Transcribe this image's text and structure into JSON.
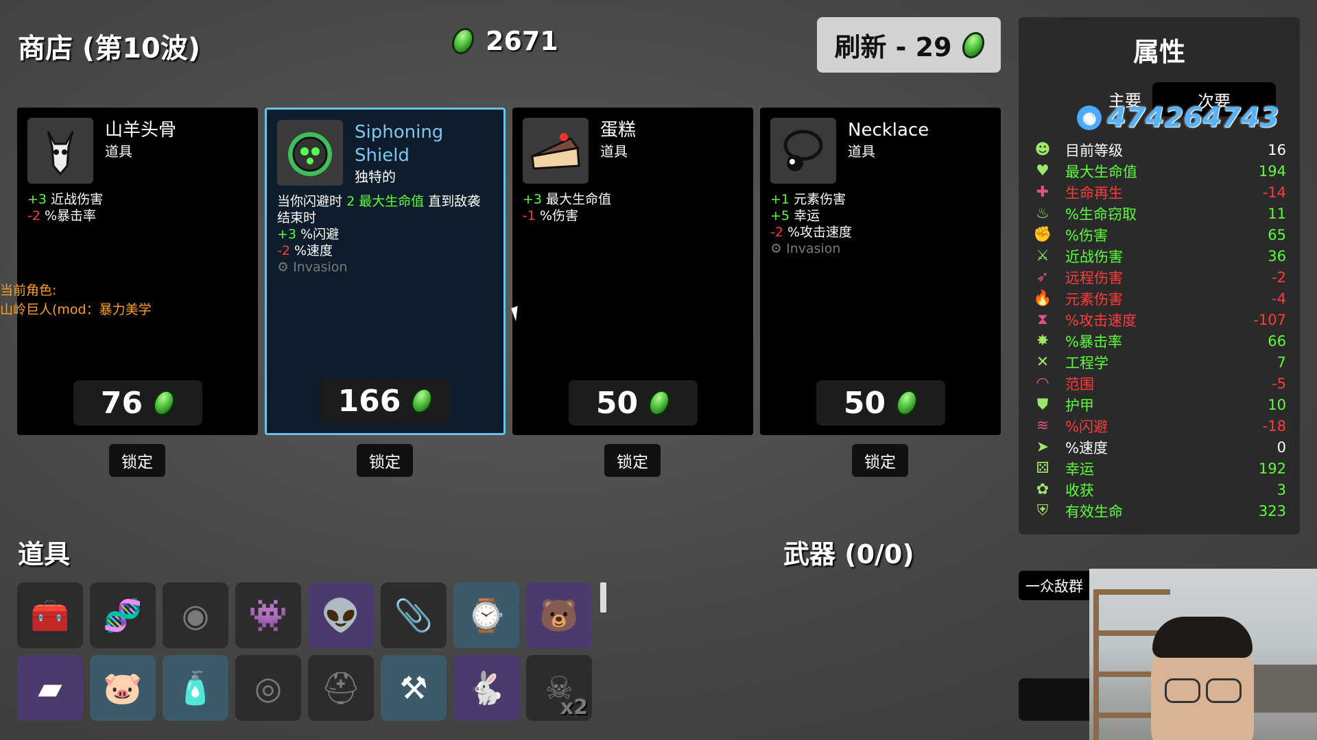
{
  "header": {
    "shop_title": "商店 (第10波)",
    "gold": "2671",
    "refresh_label": "刷新 - 29"
  },
  "shop_cards": [
    {
      "name": "山羊头骨",
      "kind": "道具",
      "price": "76",
      "lock_label": "锁定",
      "icon": "goat-skull-icon",
      "stats": [
        {
          "val": "+3",
          "txt": "近战伤害",
          "tone": "g"
        },
        {
          "val": "-2",
          "txt": "%暴击率",
          "tone": "r"
        }
      ]
    },
    {
      "name": "Siphoning Shield",
      "name_line1": "Siphoning",
      "name_line2": "Shield",
      "kind": "独特的",
      "price": "166",
      "lock_label": "锁定",
      "icon": "siphoning-shield-icon",
      "desc_pre": "当你闪避时",
      "desc_num": "2",
      "desc_stat": "最大生命值",
      "desc_post": "直到敌袭",
      "desc_line2": "结束时",
      "stats": [
        {
          "val": "+3",
          "txt": "%闪避",
          "tone": "g"
        },
        {
          "val": "-2",
          "txt": "%速度",
          "tone": "r"
        }
      ],
      "tag": "Invasion"
    },
    {
      "name": "蛋糕",
      "kind": "道具",
      "price": "50",
      "lock_label": "锁定",
      "icon": "cake-icon",
      "stats": [
        {
          "val": "+3",
          "txt": "最大生命值",
          "tone": "g"
        },
        {
          "val": "-1",
          "txt": "%伤害",
          "tone": "r"
        }
      ]
    },
    {
      "name": "Necklace",
      "kind": "道具",
      "price": "50",
      "lock_label": "锁定",
      "icon": "necklace-icon",
      "stats": [
        {
          "val": "+1",
          "txt": "元素伤害",
          "tone": "g"
        },
        {
          "val": "+5",
          "txt": "幸运",
          "tone": "g"
        },
        {
          "val": "-2",
          "txt": "%攻击速度",
          "tone": "r"
        }
      ],
      "tag": "Invasion"
    }
  ],
  "character_note": {
    "line1": "当前角色:",
    "line2": "山岭巨人(mod：暴力美学"
  },
  "items_section": {
    "title": "道具",
    "slots": [
      {
        "icon": "tool-bag-icon",
        "tone": "grey",
        "count": ""
      },
      {
        "icon": "dna-icon",
        "tone": "grey",
        "count": ""
      },
      {
        "icon": "mummy-head-icon",
        "tone": "grey",
        "count": ""
      },
      {
        "icon": "green-monster-icon",
        "tone": "grey",
        "count": ""
      },
      {
        "icon": "baby-alien-icon",
        "tone": "purple",
        "count": ""
      },
      {
        "icon": "paperclip-icon",
        "tone": "grey",
        "count": ""
      },
      {
        "icon": "pocket-watch-icon",
        "tone": "blue",
        "count": ""
      },
      {
        "icon": "bear-cub-icon",
        "tone": "purple",
        "count": ""
      },
      {
        "icon": "gold-bar-icon",
        "tone": "purple",
        "count": ""
      },
      {
        "icon": "piggy-bank-icon",
        "tone": "blue",
        "count": ""
      },
      {
        "icon": "bottle-icon",
        "tone": "blue",
        "count": ""
      },
      {
        "icon": "coin-icon",
        "tone": "grey",
        "count": ""
      },
      {
        "icon": "knight-helmet-icon",
        "tone": "grey",
        "count": ""
      },
      {
        "icon": "anvil-icon",
        "tone": "blue",
        "count": ""
      },
      {
        "icon": "white-rabbit-icon",
        "tone": "purple",
        "count": ""
      },
      {
        "icon": "goat-skull-icon",
        "tone": "grey",
        "count": "x2"
      }
    ]
  },
  "weapons_section": {
    "title": "武器 (0/0)"
  },
  "stats_panel": {
    "title": "属性",
    "tab_main": "主要",
    "tab_sub": "次要",
    "stream_id": "474264743",
    "rows": [
      {
        "icon": "level-icon",
        "name": "目前等级",
        "value": "16",
        "tone": "w"
      },
      {
        "icon": "heart-icon",
        "name": "最大生命值",
        "value": "194",
        "tone": "g"
      },
      {
        "icon": "regen-icon",
        "name": "生命再生",
        "value": "-14",
        "tone": "r"
      },
      {
        "icon": "lifesteal-icon",
        "name": "%生命窃取",
        "value": "11",
        "tone": "g"
      },
      {
        "icon": "damage-icon",
        "name": "%伤害",
        "value": "65",
        "tone": "g"
      },
      {
        "icon": "melee-icon",
        "name": "近战伤害",
        "value": "36",
        "tone": "g"
      },
      {
        "icon": "ranged-icon",
        "name": "远程伤害",
        "value": "-2",
        "tone": "r"
      },
      {
        "icon": "elemental-icon",
        "name": "元素伤害",
        "value": "-4",
        "tone": "r"
      },
      {
        "icon": "attack-speed-icon",
        "name": "%攻击速度",
        "value": "-107",
        "tone": "r"
      },
      {
        "icon": "crit-icon",
        "name": "%暴击率",
        "value": "66",
        "tone": "g"
      },
      {
        "icon": "engineering-icon",
        "name": "工程学",
        "value": "7",
        "tone": "g"
      },
      {
        "icon": "range-icon",
        "name": "范围",
        "value": "-5",
        "tone": "r"
      },
      {
        "icon": "armor-icon",
        "name": "护甲",
        "value": "10",
        "tone": "g"
      },
      {
        "icon": "dodge-icon",
        "name": "%闪避",
        "value": "-18",
        "tone": "r"
      },
      {
        "icon": "speed-icon",
        "name": "%速度",
        "value": "0",
        "tone": "w"
      },
      {
        "icon": "luck-icon",
        "name": "幸运",
        "value": "192",
        "tone": "g"
      },
      {
        "icon": "harvest-icon",
        "name": "收获",
        "value": "3",
        "tone": "g"
      },
      {
        "icon": "effective-hp-icon",
        "name": "有效生命",
        "value": "323",
        "tone": "g"
      }
    ]
  },
  "enemy_banner": "一众敌群",
  "colors": {
    "positive": "#5cff3a",
    "negative": "#ff3b3b",
    "accent_blue": "#7cc6f0",
    "material_green": "#5fd14a"
  }
}
